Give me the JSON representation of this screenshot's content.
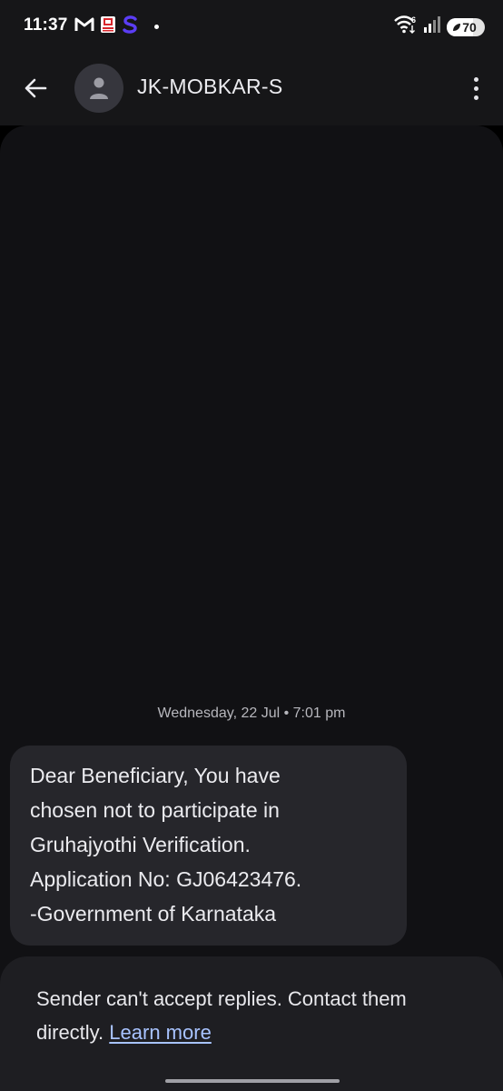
{
  "status_bar": {
    "time": "11:37",
    "left_icons": [
      "gmail-icon",
      "app-notification-icon",
      "s-app-icon",
      "dot-icon"
    ],
    "right_icons": [
      "wifi-6-icon",
      "signal-icon",
      "battery-icon"
    ],
    "wifi_label": "6",
    "battery_level": "70"
  },
  "app_bar": {
    "back_icon": "arrow-left-icon",
    "avatar_icon": "person-icon",
    "contact_name": "JK-MOBKAR-S",
    "menu_icon": "more-vert-icon"
  },
  "conversation": {
    "date_divider": "Wednesday, 22 Jul • 7:01 pm",
    "messages": [
      {
        "text": "Dear Beneficiary, You have\nchosen not to participate in\nGruhajyothi Verification.\nApplication No: GJ06423476.\n-Government of Karnataka"
      }
    ]
  },
  "footer": {
    "notice": "Sender can't accept replies. Contact them directly.",
    "link": "Learn more"
  },
  "colors": {
    "background": "#111114",
    "bubble": "#26262b",
    "link": "#a8c3ff",
    "s_app_accent": "#5b3df5"
  }
}
